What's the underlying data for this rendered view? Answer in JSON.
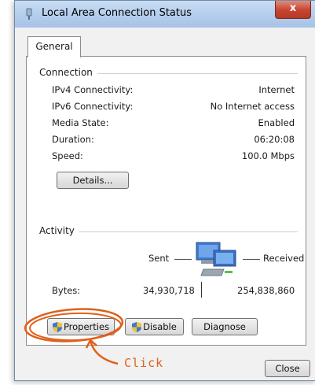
{
  "window": {
    "title": "Local Area Connection Status",
    "close_glyph": "x"
  },
  "tabs": [
    {
      "label": "General"
    }
  ],
  "connection": {
    "group_label": "Connection",
    "rows": [
      {
        "label": "IPv4 Connectivity:",
        "value": "Internet"
      },
      {
        "label": "IPv6 Connectivity:",
        "value": "No Internet access"
      },
      {
        "label": "Media State:",
        "value": "Enabled"
      },
      {
        "label": "Duration:",
        "value": "06:20:08"
      },
      {
        "label": "Speed:",
        "value": "100.0 Mbps"
      }
    ],
    "details_button": "Details..."
  },
  "activity": {
    "group_label": "Activity",
    "sent_label": "Sent",
    "received_label": "Received",
    "bytes_label": "Bytes:",
    "bytes_sent": "34,930,718",
    "bytes_received": "254,838,860"
  },
  "buttons": {
    "properties": "Properties",
    "disable": "Disable",
    "diagnose": "Diagnose",
    "close": "Close"
  },
  "annotation": {
    "text": "Click",
    "color": "#e0601b"
  },
  "icons": {
    "title": "network-connection-icon",
    "activity": "network-computers-icon",
    "uac": "uac-shield-icon"
  }
}
